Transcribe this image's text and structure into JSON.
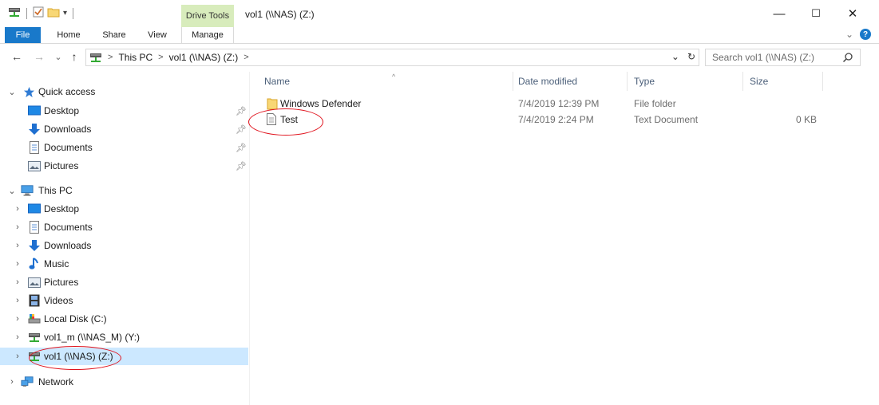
{
  "window": {
    "title": "vol1 (\\\\NAS) (Z:)",
    "controls": {
      "minimize": "—",
      "maximize": "☐",
      "close": "✕"
    }
  },
  "ribbon": {
    "contextual_group": "Drive Tools",
    "tabs": [
      "File",
      "Home",
      "Share",
      "View",
      "Manage"
    ],
    "expand": "⌄",
    "help": "?"
  },
  "navigation": {
    "back": "←",
    "forward": "→",
    "recent": "⌄",
    "up": "↑"
  },
  "address": {
    "crumbs": [
      "This PC",
      "vol1 (\\\\NAS) (Z:)"
    ],
    "separator": ">",
    "dropdown": "⌄",
    "refresh": "↻"
  },
  "search": {
    "placeholder": "Search vol1 (\\\\NAS) (Z:)"
  },
  "nav_pane": {
    "quick_access": {
      "label": "Quick access",
      "items": [
        "Desktop",
        "Downloads",
        "Documents",
        "Pictures"
      ]
    },
    "this_pc": {
      "label": "This PC",
      "items": [
        "Desktop",
        "Documents",
        "Downloads",
        "Music",
        "Pictures",
        "Videos",
        "Local Disk (C:)",
        "vol1_m (\\\\NAS_M) (Y:)",
        "vol1 (\\\\NAS) (Z:)"
      ]
    },
    "network": {
      "label": "Network"
    },
    "selected": "vol1 (\\\\NAS) (Z:)"
  },
  "columns": [
    "Name",
    "Date modified",
    "Type",
    "Size"
  ],
  "files": [
    {
      "name": "Windows Defender",
      "date": "7/4/2019 12:39 PM",
      "type": "File folder",
      "size": "",
      "icon": "folder-icon"
    },
    {
      "name": "Test",
      "date": "7/4/2019 2:24 PM",
      "type": "Text Document",
      "size": "0 KB",
      "icon": "text-document-icon"
    }
  ],
  "colors": {
    "accent": "#1979ca",
    "selection": "#cce8ff",
    "contextual_tab": "#d8ecbc",
    "annotation": "#e0141e"
  }
}
